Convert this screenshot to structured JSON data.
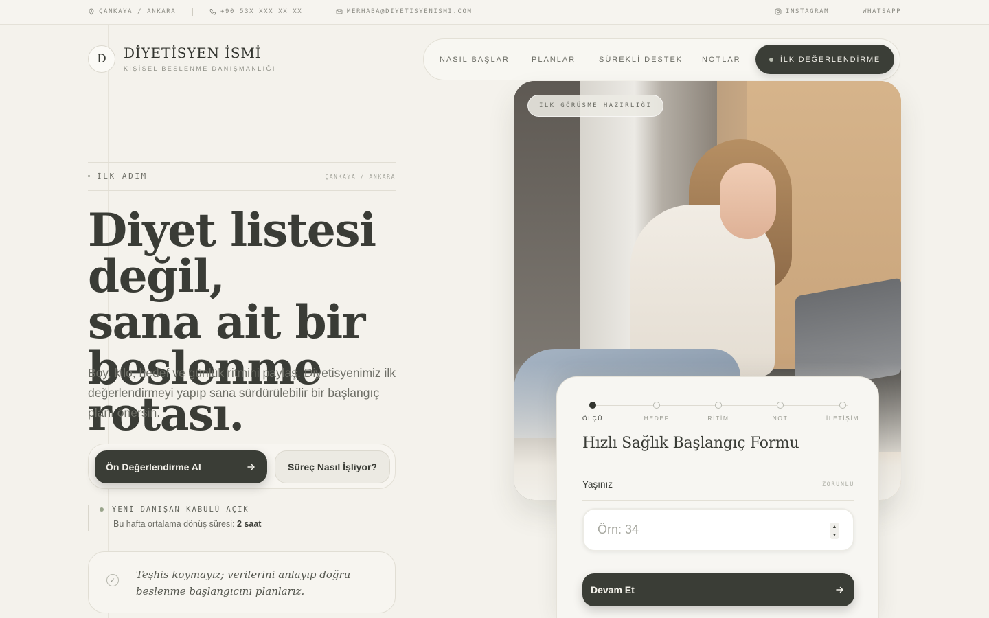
{
  "topbar": {
    "location": "ÇANKAYA / ANKARA",
    "phone": "+90 53X XXX XX XX",
    "email": "MERHABA@DİYETİSYENİSMİ.COM",
    "instagram": "INSTAGRAM",
    "whatsapp": "WHATSAPP"
  },
  "brand": {
    "initial": "D",
    "name": "DİYETİSYEN İSMİ",
    "tagline": "KİŞİSEL BESLENME DANIŞMANLIĞI"
  },
  "nav": {
    "items": [
      "NASIL BAŞLAR",
      "PLANLAR",
      "SÜREKLİ DESTEK",
      "NOTLAR"
    ],
    "cta": "İLK DEĞERLENDİRME"
  },
  "hero": {
    "eyebrow": "İLK ADIM",
    "eyebrow_location": "ÇANKAYA / ANKARA",
    "headline": [
      "Diyet listesi değil,",
      "sana ait bir",
      "beslenme rotası."
    ],
    "lead": "Boy, kilo, hedef ve günlük ritmini paylaş. Diyetisyenimiz ilk değerlendirmeyi yapıp sana sürdürülebilir bir başlangıç planı önersin.",
    "primary_button": "Ön Değerlendirme Al",
    "secondary_button": "Süreç Nasıl İşliyor?",
    "status_title": "YENİ DANIŞAN KABULÜ AÇIK",
    "status_text": "Bu hafta ortalama dönüş süresi:",
    "status_value": "2 saat",
    "note": "Teşhis koymayız; verilerini anlayıp doğru beslenme başlangıcını planlarız."
  },
  "photo": {
    "badge": "İLK GÖRÜŞME HAZIRLIĞI"
  },
  "form": {
    "steps": [
      "ÖLÇÜ",
      "HEDEF",
      "RİTİM",
      "NOT",
      "İLETİŞİM"
    ],
    "active_step": 0,
    "title": "Hızlı Sağlık Başlangıç Formu",
    "field_label": "Yaşınız",
    "field_required": "ZORUNLU",
    "field_placeholder": "Örn: 34",
    "field_value": "",
    "continue_button": "Devam Et"
  },
  "colors": {
    "background": "#f4f2ec",
    "dark": "#3a3d36",
    "accent_green": "#9aa58c"
  },
  "icons": {
    "location": "map-pin-icon",
    "phone": "phone-icon",
    "email": "mail-icon",
    "instagram": "instagram-icon",
    "arrow": "arrow-right-icon",
    "check": "check-circle-icon"
  }
}
